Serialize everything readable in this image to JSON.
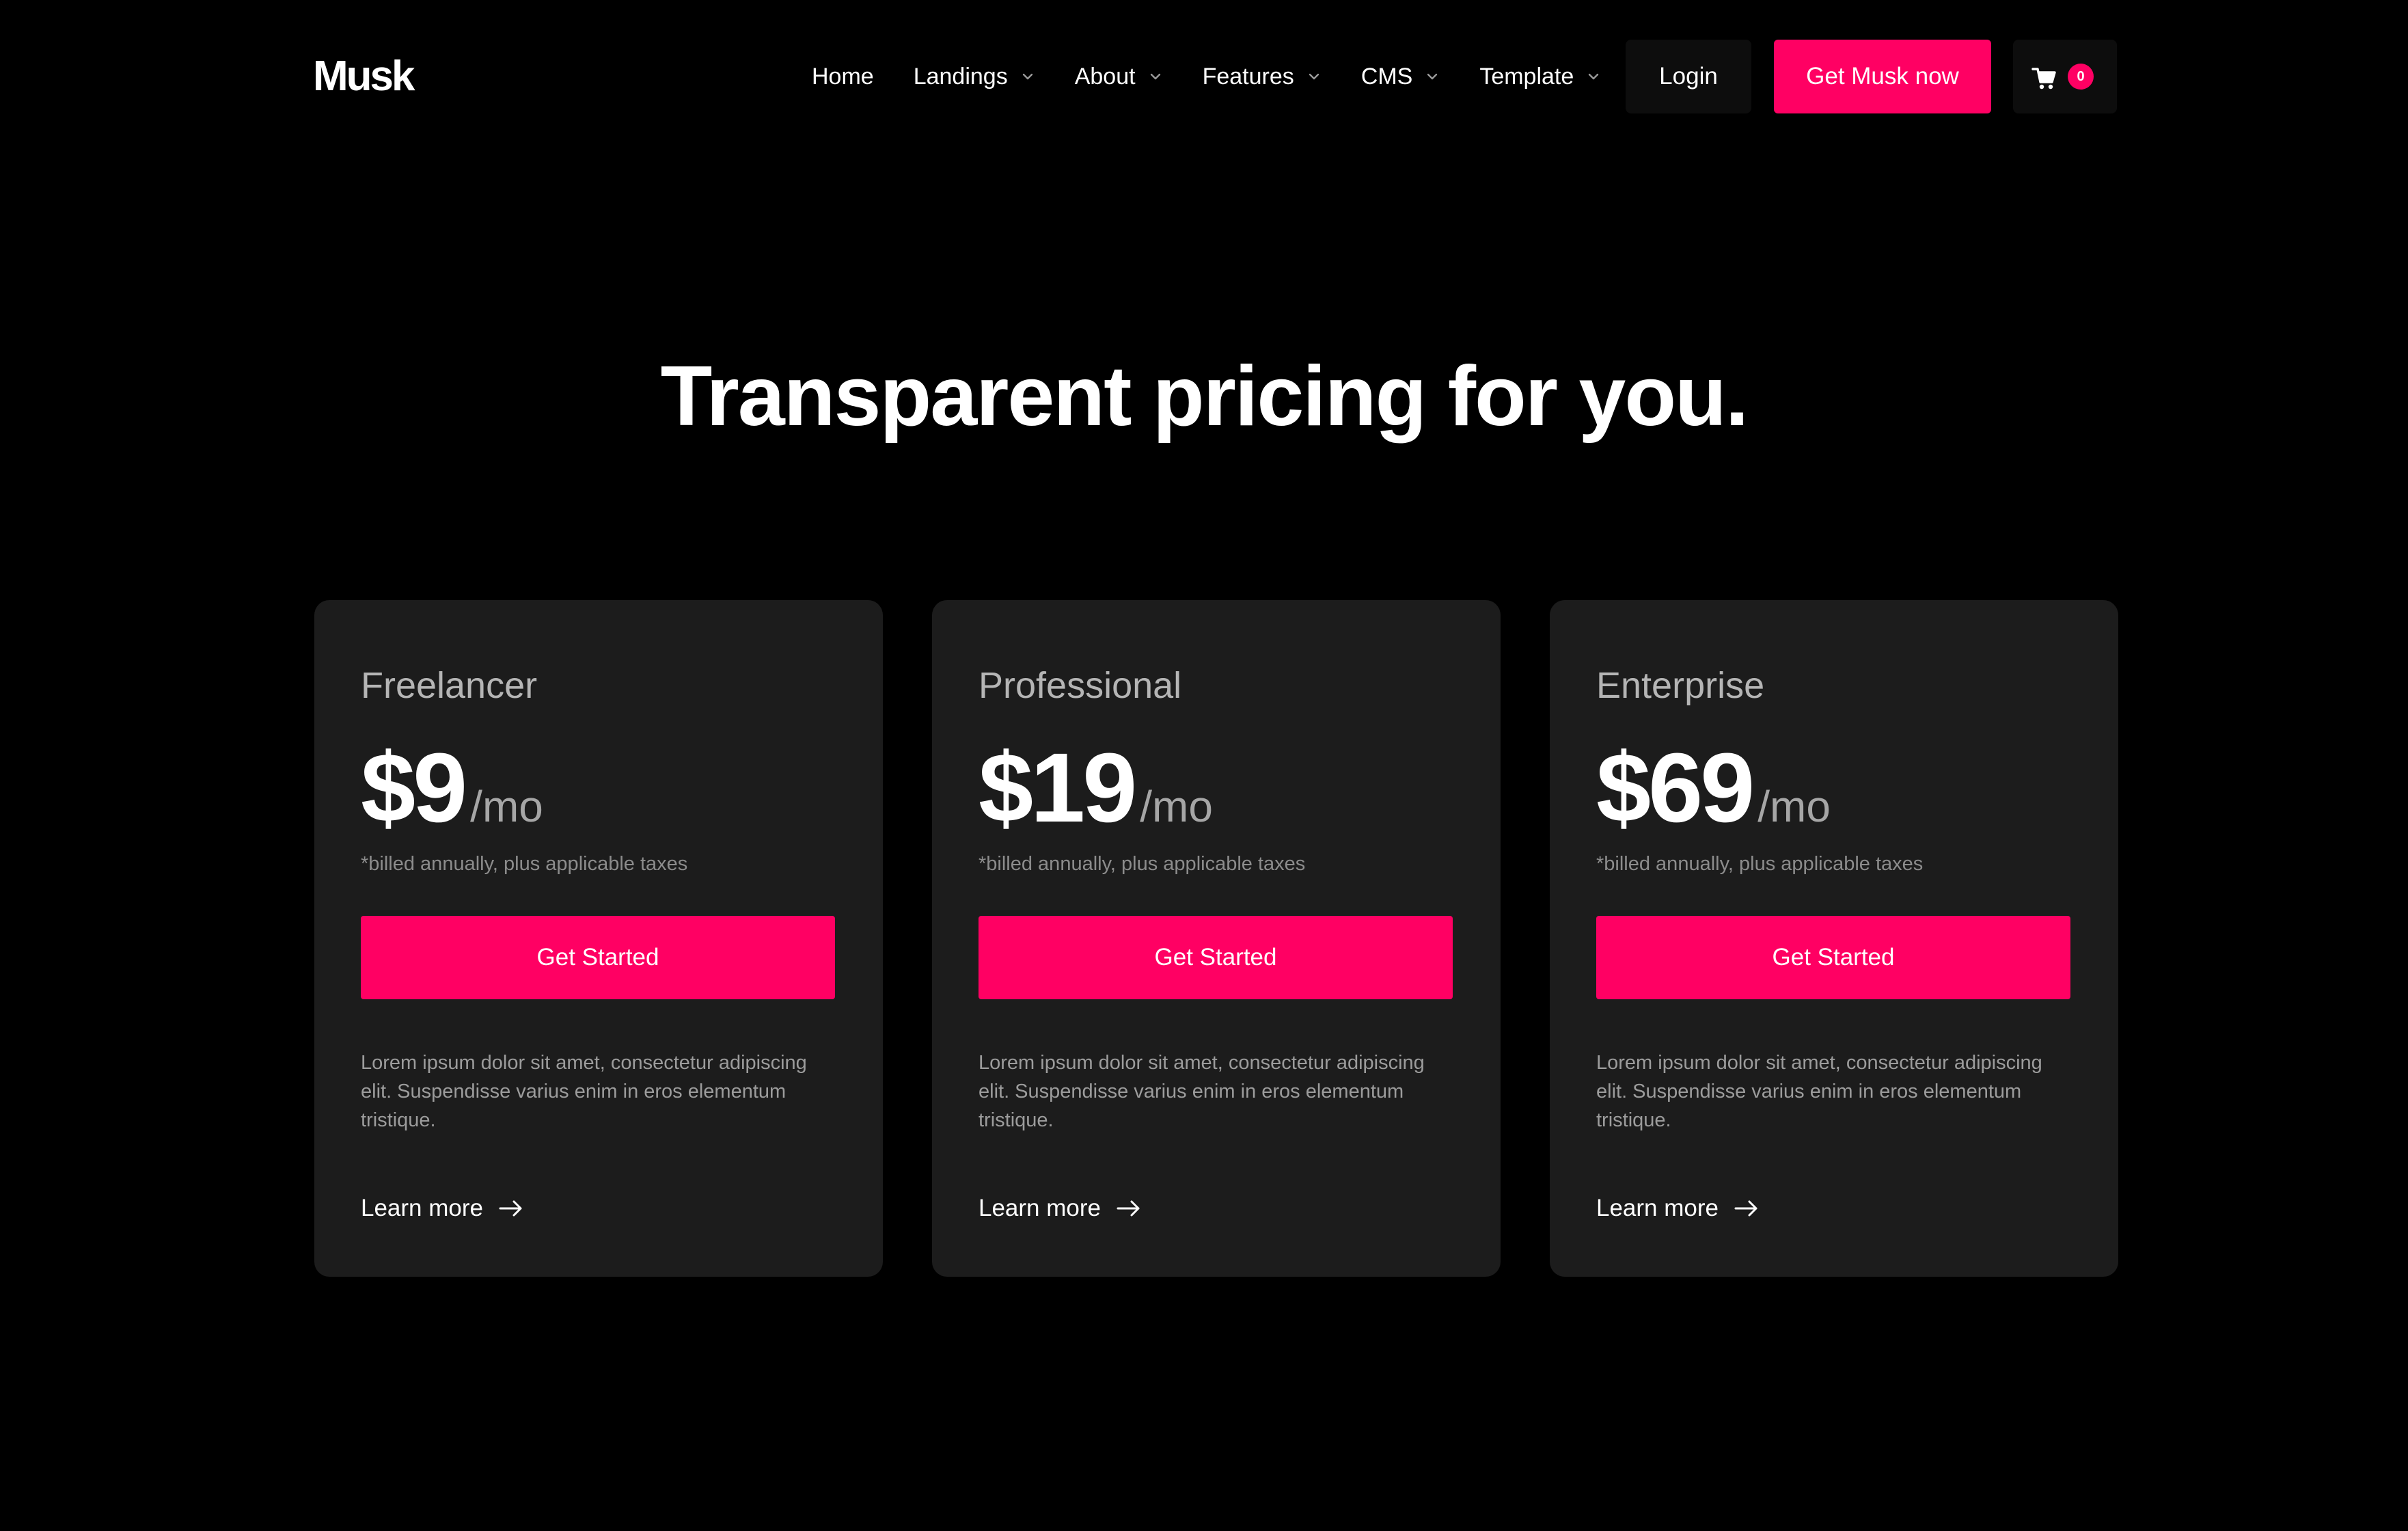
{
  "header": {
    "logo": "Musk",
    "nav": [
      {
        "label": "Home",
        "has_dropdown": false
      },
      {
        "label": "Landings",
        "has_dropdown": true
      },
      {
        "label": "About",
        "has_dropdown": true
      },
      {
        "label": "Features",
        "has_dropdown": true
      },
      {
        "label": "CMS",
        "has_dropdown": true
      },
      {
        "label": "Template",
        "has_dropdown": true
      }
    ],
    "login_label": "Login",
    "cta_label": "Get Musk now",
    "cart_count": "0",
    "cart_icon": "shopping-cart-icon"
  },
  "hero": {
    "title": "Transparent pricing for you."
  },
  "plans": [
    {
      "name": "Freelancer",
      "price": "$9",
      "period": "/mo",
      "billing": "*billed annually, plus applicable taxes",
      "cta": "Get Started",
      "description": "Lorem ipsum dolor sit amet, consectetur adipiscing elit. Suspendisse varius enim in eros elementum tristique.",
      "link": "Learn more"
    },
    {
      "name": "Professional",
      "price": "$19",
      "period": "/mo",
      "billing": "*billed annually, plus applicable taxes",
      "cta": "Get Started",
      "description": "Lorem ipsum dolor sit amet, consectetur adipiscing elit. Suspendisse varius enim in eros elementum tristique.",
      "link": "Learn more"
    },
    {
      "name": "Enterprise",
      "price": "$69",
      "period": "/mo",
      "billing": "*billed annually, plus applicable taxes",
      "cta": "Get Started",
      "description": "Lorem ipsum dolor sit amet, consectetur adipiscing elit. Suspendisse varius enim in eros elementum tristique.",
      "link": "Learn more"
    }
  ],
  "colors": {
    "background": "#000000",
    "accent": "#ff0063",
    "card": "#1c1c1c",
    "button_dark": "#0d0d0d"
  }
}
